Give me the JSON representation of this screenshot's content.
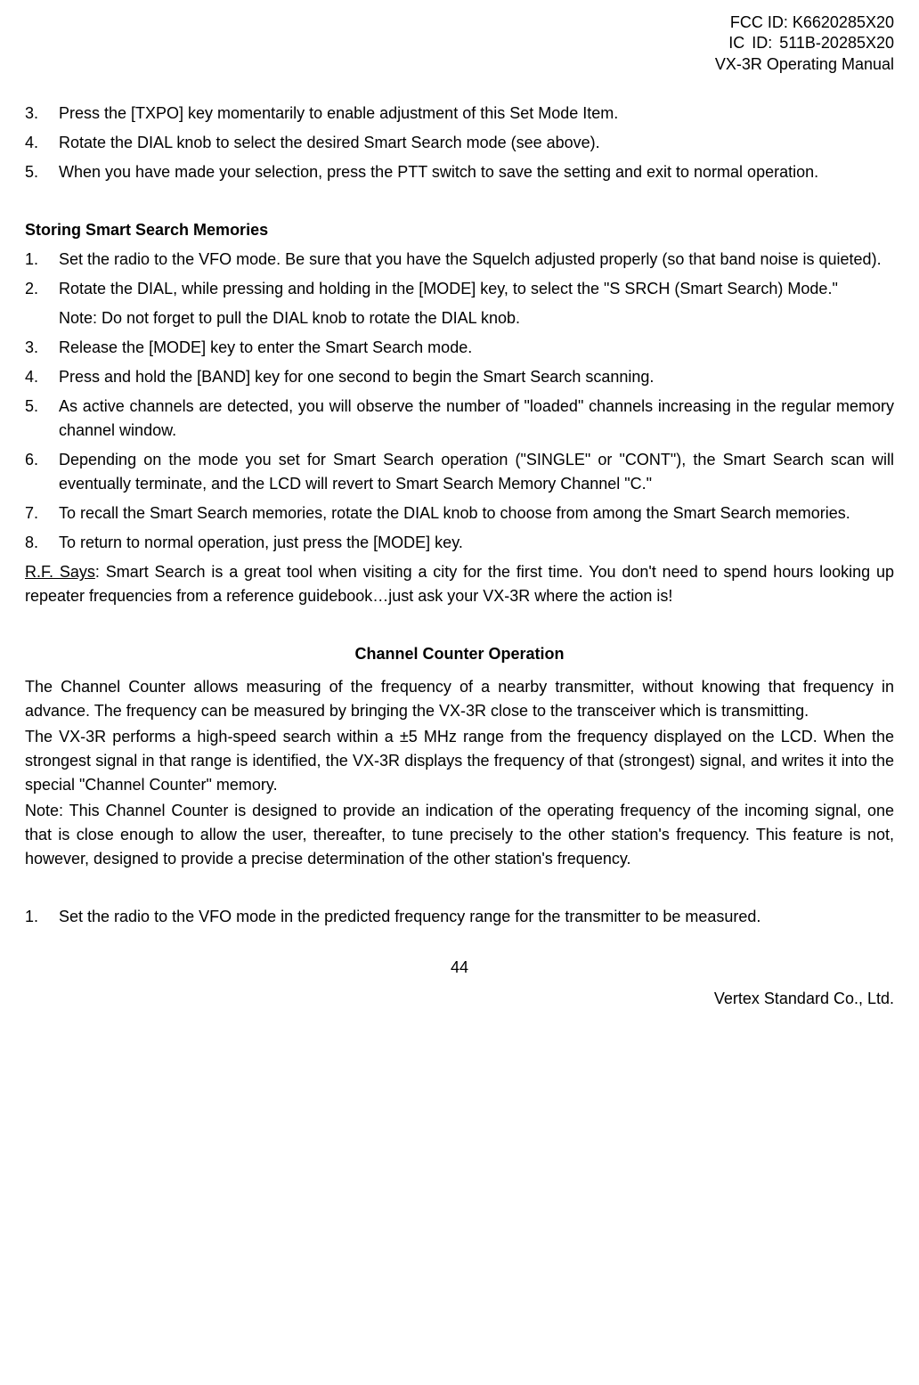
{
  "header": {
    "fcc_id": "FCC ID: K6620285X20",
    "ic_id": "IC ID: 511B-20285X20",
    "manual": "VX-3R Operating Manual"
  },
  "list1": [
    {
      "num": "3.",
      "text": "Press the [TXPO] key momentarily to enable adjustment of this Set Mode Item."
    },
    {
      "num": "4.",
      "text": "Rotate the DIAL knob to select the desired Smart Search mode (see above)."
    },
    {
      "num": "5.",
      "text": "When you have made your selection, press the PTT switch to save the setting and exit to normal operation."
    }
  ],
  "heading1": "Storing Smart Search Memories",
  "list2": [
    {
      "num": "1.",
      "text": "Set the radio to the VFO mode. Be sure that you have the Squelch adjusted properly (so that band noise is quieted)."
    },
    {
      "num": "2.",
      "text": "Rotate the DIAL, while pressing and holding in the [MODE] key, to select the \"S SRCH (Smart Search) Mode.\""
    }
  ],
  "note2": "Note: Do not forget to pull the DIAL knob to rotate the DIAL knob.",
  "list3": [
    {
      "num": "3.",
      "text": "Release the [MODE] key to enter the Smart Search mode."
    },
    {
      "num": "4.",
      "text": "Press and hold the [BAND] key for one second to begin the Smart Search scanning."
    },
    {
      "num": "5.",
      "text": "As active channels are detected, you will observe the number of \"loaded\" channels increasing in the regular memory channel window."
    },
    {
      "num": "6.",
      "text": "Depending on the mode you set for Smart Search operation (\"SINGLE\" or \"CONT\"), the Smart Search scan will eventually terminate, and the LCD will revert to Smart Search Memory Channel \"C.\""
    },
    {
      "num": "7.",
      "text": "To recall the Smart Search memories, rotate the DIAL knob to choose from among the Smart Search memories."
    },
    {
      "num": "8.",
      "text": "To return to normal operation, just press the [MODE] key."
    }
  ],
  "rf_says_label": "R.F. Says",
  "rf_says_text": ": Smart Search is a great tool when visiting a city for the first time. You don't need to spend hours looking up repeater frequencies from a reference guidebook…just ask your VX-3R where the action is!",
  "heading2": "Channel Counter Operation",
  "para1": "The Channel Counter allows measuring of the frequency of a nearby transmitter, without knowing that frequency in advance. The frequency can be measured by bringing the VX-3R close to the transceiver which is transmitting.",
  "para2": "The VX-3R performs a high-speed search within a ±5 MHz range from the frequency displayed on the LCD. When the strongest signal in that range is identified, the VX-3R displays the frequency of that (strongest) signal, and writes it into the special \"Channel Counter\" memory.",
  "para3": "Note: This Channel Counter is designed to provide an indication of the operating frequency of the incoming signal, one that is close enough to allow the user, thereafter,  to tune precisely to the other station's frequency. This feature is not, however, designed to provide a precise determination of the other station's frequency.",
  "list4": [
    {
      "num": "1.",
      "text": "Set the radio to the VFO mode in the predicted frequency range for the transmitter to be measured."
    }
  ],
  "pagenum": "44",
  "company": "Vertex Standard Co., Ltd."
}
